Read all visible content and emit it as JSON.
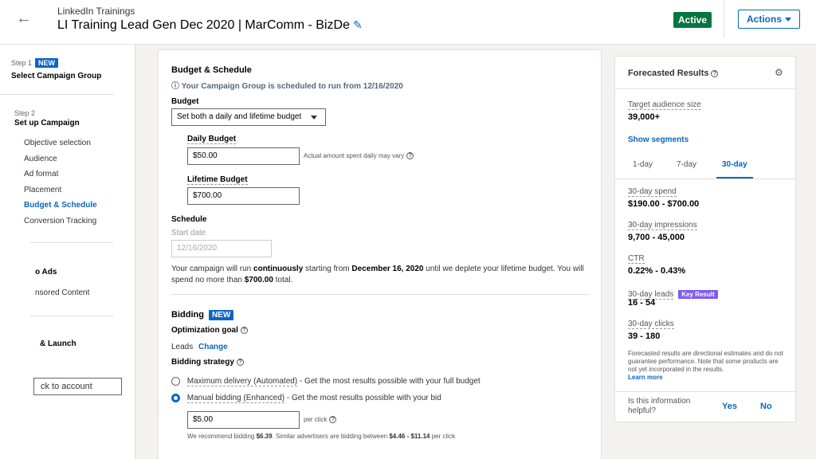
{
  "header": {
    "back_icon": "arrow-left-icon",
    "account_name": "LinkedIn Trainings",
    "campaign_title": "LI Training Lead Gen Dec 2020 | MarComm - BizDe",
    "edit_icon": "pencil-icon",
    "status": "Active",
    "status_color": "#057642",
    "actions_label": "Actions"
  },
  "sidebar": {
    "step1": {
      "label": "Step 1",
      "badge": "NEW",
      "title": "Select Campaign Group"
    },
    "step2": {
      "label": "Step 2",
      "title": "Set up Campaign"
    },
    "items": [
      {
        "label": "Objective selection"
      },
      {
        "label": "Audience"
      },
      {
        "label": "Ad format"
      },
      {
        "label": "Placement"
      },
      {
        "label": "Budget & Schedule"
      },
      {
        "label": "Conversion Tracking"
      }
    ],
    "step3": {
      "label": "",
      "title": "o Ads",
      "item": "nsored Content"
    },
    "step4": {
      "title": "& Launch"
    },
    "back_button": "ck to account"
  },
  "budget": {
    "section_title": "Budget & Schedule",
    "info_text": "Your Campaign Group is scheduled to run from 12/16/2020",
    "budget_label": "Budget",
    "budget_select": "Set both a daily and lifetime budget",
    "daily_label": "Daily Budget",
    "daily_value": "$50.00",
    "daily_hint": "Actual amount spent daily may vary",
    "lifetime_label": "Lifetime Budget",
    "lifetime_value": "$700.00",
    "schedule_label": "Schedule",
    "start_date_label": "Start date",
    "start_date_value": "12/16/2020",
    "summary_1": "Your campaign will run ",
    "summary_2": "continuously",
    "summary_3": " starting from ",
    "summary_4": "December 16, 2020",
    "summary_5": " until we deplete your lifetime budget. You will spend no more than ",
    "summary_6": "$700.00",
    "summary_7": " total."
  },
  "bidding": {
    "section_title": "Bidding",
    "badge": "NEW",
    "goal_label": "Optimization goal",
    "goal_value": "Leads",
    "change_link": "Change",
    "strategy_label": "Bidding strategy",
    "options": [
      {
        "name": "Maximum delivery (Automated)",
        "desc": " - Get the most results possible with your full budget",
        "selected": false
      },
      {
        "name": "Manual bidding (Enhanced)",
        "desc": " - Get the most results possible with your bid",
        "selected": true
      }
    ],
    "bid_value": "$5.00",
    "bid_unit": "per click",
    "rec_1": "We recommend bidding ",
    "rec_2": "$6.39",
    "rec_3": ". Similar advertisers are bidding between ",
    "rec_4": "$4.46 - $11.14",
    "rec_5": " per click"
  },
  "forecast": {
    "title": "Forecasted Results",
    "settings_icon": "gear-icon",
    "audience_label": "Target audience size",
    "audience_value": "39,000+",
    "show_segments": "Show segments",
    "tabs": [
      "1-day",
      "7-day",
      "30-day"
    ],
    "active_tab": "30-day",
    "metrics": [
      {
        "label": "30-day spend",
        "value": "$190.00 - $700.00"
      },
      {
        "label": "30-day impressions",
        "value": "9,700 - 45,000"
      },
      {
        "label": "CTR",
        "value": "0.22% - 0.43%"
      },
      {
        "label": "30-day leads",
        "value": "16 - 54",
        "badge": "Key Result"
      },
      {
        "label": "30-day clicks",
        "value": "39 - 180"
      }
    ],
    "disclaimer": "Forecasted results are directional estimates and do not guarantee performance. Note that some products are not yet incorporated in the results.",
    "learn_more": "Learn more",
    "helpful_question": "Is this information helpful?",
    "yes": "Yes",
    "no": "No"
  },
  "colors": {
    "accent": "#0a66c2",
    "key_result": "#7f5af0"
  }
}
